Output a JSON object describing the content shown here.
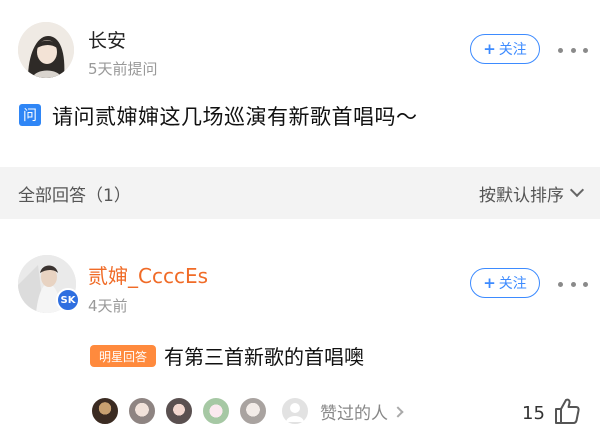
{
  "question": {
    "asker": {
      "name": "长安",
      "time": "5天前提问"
    },
    "follow_label": "关注",
    "icon_label": "问",
    "text": "请问贰婶婶这几场巡演有新歌首唱吗～"
  },
  "answers_header": {
    "count_label": "全部回答（1）",
    "sort_label": "按默认排序"
  },
  "answer": {
    "name": "贰婶_CcccEs",
    "time": "4天前",
    "follow_label": "关注",
    "verify_badge": "SK",
    "star_badge": "明星回答",
    "text": "有第三首新歌的首唱噢",
    "liked_label": "赞过的人",
    "like_count": "15"
  },
  "colors": {
    "accent": "#3d8bff",
    "answerer_name": "#f06b27",
    "star_badge": "#ff8a3d"
  },
  "icons": [
    "more-icon",
    "question-icon",
    "chevron-down-icon",
    "chevron-right-icon",
    "verified-icon",
    "thumbs-up-icon"
  ]
}
